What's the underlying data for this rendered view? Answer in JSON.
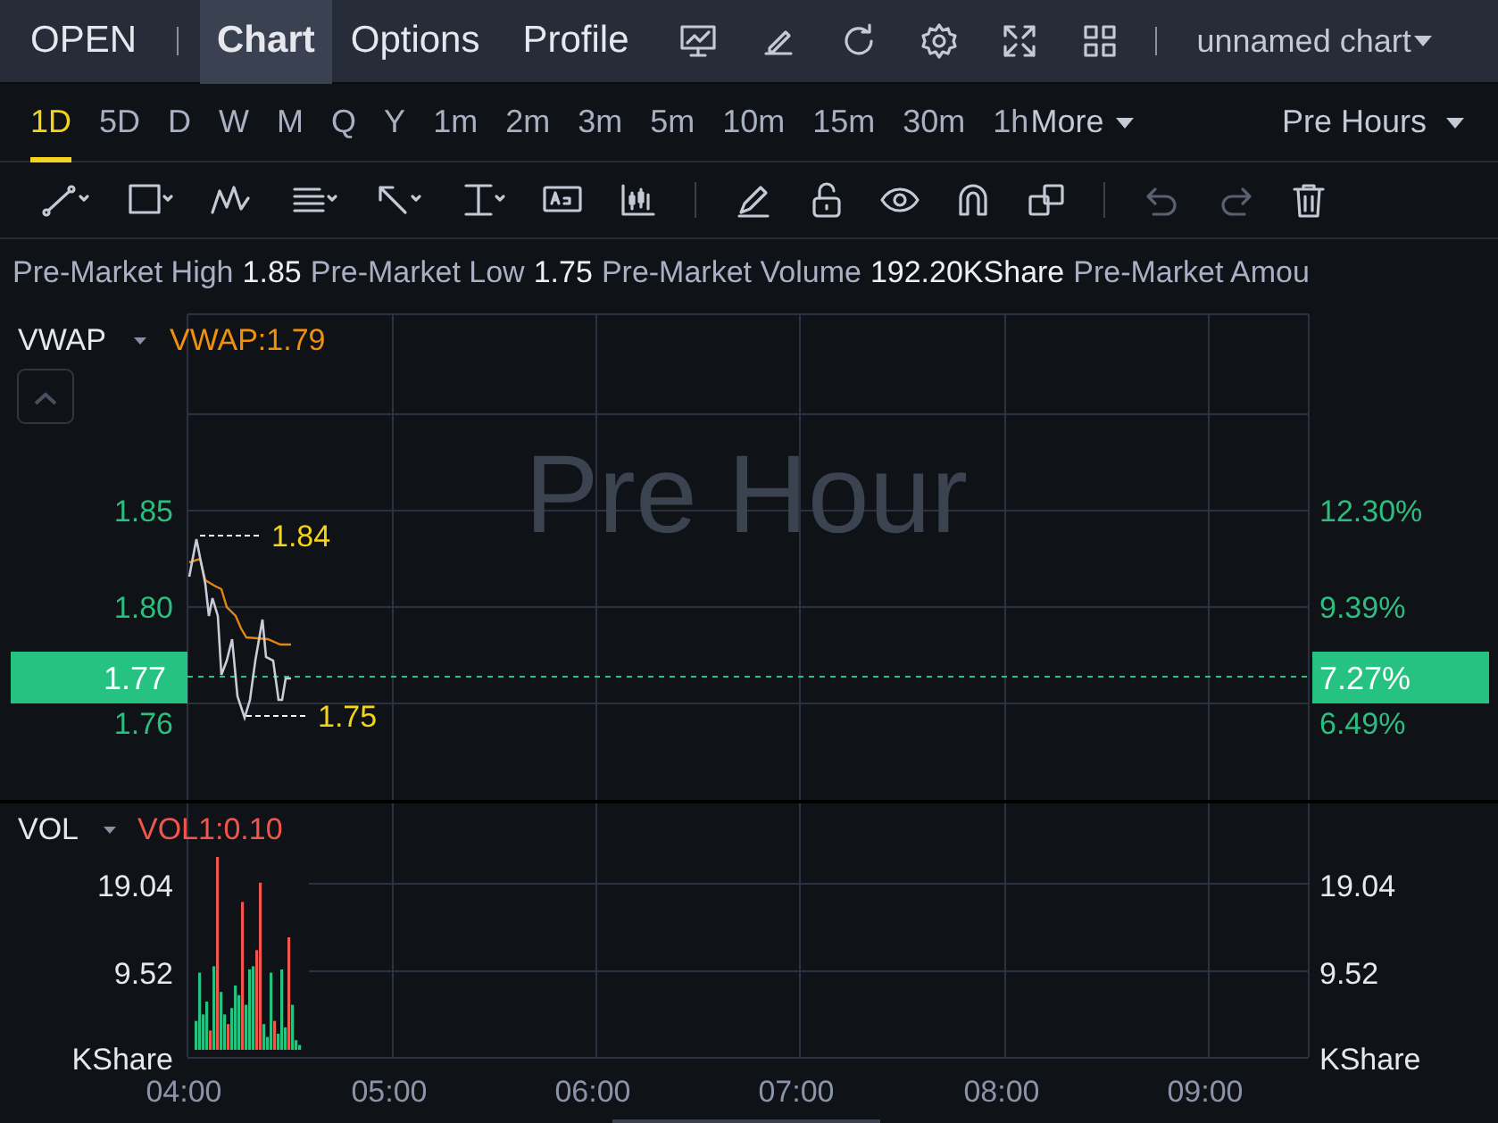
{
  "header": {
    "symbol": "OPEN",
    "tabs": [
      {
        "label": "Chart",
        "selected": true
      },
      {
        "label": "Options",
        "selected": false
      },
      {
        "label": "Profile",
        "selected": false
      }
    ],
    "chart_name": "unnamed chart"
  },
  "timeframes": [
    {
      "label": "1D",
      "selected": true
    },
    {
      "label": "5D",
      "selected": false
    },
    {
      "label": "D",
      "selected": false
    },
    {
      "label": "W",
      "selected": false
    },
    {
      "label": "M",
      "selected": false
    },
    {
      "label": "Q",
      "selected": false
    },
    {
      "label": "Y",
      "selected": false
    },
    {
      "label": "1m",
      "selected": false
    },
    {
      "label": "2m",
      "selected": false
    },
    {
      "label": "3m",
      "selected": false
    },
    {
      "label": "5m",
      "selected": false
    },
    {
      "label": "10m",
      "selected": false
    },
    {
      "label": "15m",
      "selected": false
    },
    {
      "label": "30m",
      "selected": false
    },
    {
      "label": "1h",
      "selected": false
    }
  ],
  "more": "More",
  "session": "Pre Hours",
  "stats": [
    {
      "label": "Pre-Market High",
      "value": "1.85"
    },
    {
      "label": "Pre-Market Low",
      "value": "1.75"
    },
    {
      "label": "Pre-Market Volume",
      "value": "192.20KShare"
    },
    {
      "label": "Pre-Market Amou"
    }
  ],
  "price_pane": {
    "indicator": "VWAP",
    "indicator_value": "VWAP:1.79",
    "watermark": "Pre Hour",
    "left_axis": [
      "1.85",
      "1.80",
      "1.76"
    ],
    "right_axis": [
      "12.30%",
      "9.39%",
      "6.49%"
    ],
    "last_price": "1.77",
    "last_change": "7.27%",
    "high_label": "1.84",
    "low_label": "1.75"
  },
  "volume_pane": {
    "indicator": "VOL",
    "indicator_value": "VOL1:0.10",
    "left_axis": [
      "19.04",
      "9.52",
      "KShare"
    ],
    "right_axis": [
      "19.04",
      "9.52",
      "KShare"
    ]
  },
  "x_axis": [
    "04:00",
    "05:00",
    "06:00",
    "07:00",
    "08:00",
    "09:00"
  ]
}
